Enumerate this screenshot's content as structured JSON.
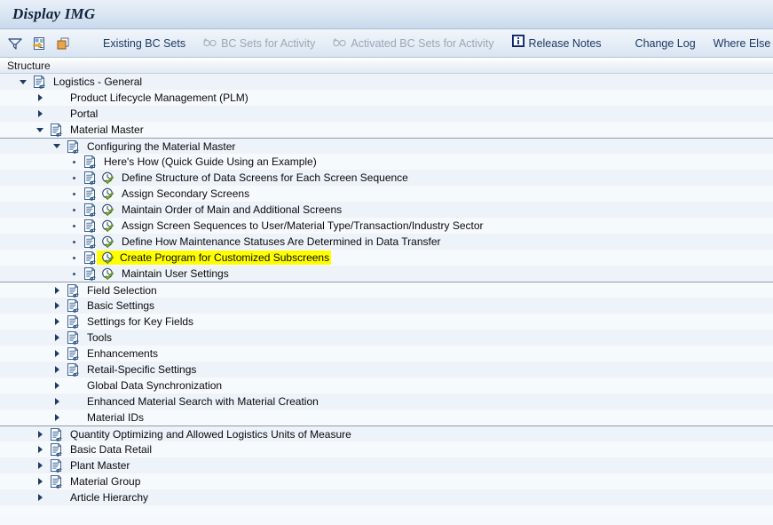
{
  "window": {
    "title": "Display IMG"
  },
  "toolbar": {
    "icons": [
      {
        "name": "filter-icon",
        "label": "Filter"
      },
      {
        "name": "display-details-icon",
        "label": "Display Details"
      },
      {
        "name": "copy-icon",
        "label": "Copy"
      }
    ],
    "buttons": [
      {
        "label": "Existing BC Sets",
        "disabled": false,
        "icon": "none"
      },
      {
        "label": "BC Sets for Activity",
        "disabled": true,
        "icon": "glasses-icon"
      },
      {
        "label": "Activated BC Sets for Activity",
        "disabled": true,
        "icon": "glasses-icon"
      },
      {
        "label": "Release Notes",
        "disabled": false,
        "icon": "info-icon"
      },
      {
        "label": "Change Log",
        "disabled": false,
        "icon": "none"
      },
      {
        "label": "Where Else Used",
        "disabled": false,
        "icon": "none"
      }
    ]
  },
  "structure": {
    "header": "Structure",
    "rows": [
      {
        "label": "Logistics - General",
        "indent": 0,
        "marker": "down",
        "doc": true,
        "clock": false,
        "highlight": false,
        "band": "a",
        "sep": false
      },
      {
        "label": "Product Lifecycle Management (PLM)",
        "indent": 1,
        "marker": "right",
        "doc": false,
        "clock": false,
        "highlight": false,
        "band": "b",
        "sep": false
      },
      {
        "label": "Portal",
        "indent": 1,
        "marker": "right",
        "doc": false,
        "clock": false,
        "highlight": false,
        "band": "a",
        "sep": false
      },
      {
        "label": "Material Master",
        "indent": 1,
        "marker": "down",
        "doc": true,
        "clock": false,
        "highlight": false,
        "band": "b",
        "sep": false
      },
      {
        "label": "Configuring the Material Master",
        "indent": 2,
        "marker": "down",
        "doc": true,
        "clock": false,
        "highlight": false,
        "band": "a",
        "sep": true
      },
      {
        "label": "Here's How (Quick Guide Using an Example)",
        "indent": 3,
        "marker": "dot",
        "doc": true,
        "clock": false,
        "highlight": false,
        "band": "b",
        "sep": false
      },
      {
        "label": "Define Structure of Data Screens for Each Screen Sequence",
        "indent": 3,
        "marker": "dot",
        "doc": true,
        "clock": true,
        "highlight": false,
        "band": "a",
        "sep": false
      },
      {
        "label": "Assign Secondary Screens",
        "indent": 3,
        "marker": "dot",
        "doc": true,
        "clock": true,
        "highlight": false,
        "band": "b",
        "sep": false
      },
      {
        "label": "Maintain Order of Main and Additional Screens",
        "indent": 3,
        "marker": "dot",
        "doc": true,
        "clock": true,
        "highlight": false,
        "band": "a",
        "sep": false
      },
      {
        "label": "Assign Screen Sequences to User/Material Type/Transaction/Industry Sector",
        "indent": 3,
        "marker": "dot",
        "doc": true,
        "clock": true,
        "highlight": false,
        "band": "b",
        "sep": false
      },
      {
        "label": "Define How Maintenance Statuses Are Determined in Data Transfer",
        "indent": 3,
        "marker": "dot",
        "doc": true,
        "clock": true,
        "highlight": false,
        "band": "a",
        "sep": false
      },
      {
        "label": "Create Program for Customized Subscreens",
        "indent": 3,
        "marker": "dot",
        "doc": true,
        "clock": true,
        "highlight": true,
        "band": "b",
        "sep": false
      },
      {
        "label": "Maintain User Settings",
        "indent": 3,
        "marker": "dot",
        "doc": true,
        "clock": true,
        "highlight": false,
        "band": "a",
        "sep": false
      },
      {
        "label": "Field Selection",
        "indent": 2,
        "marker": "right",
        "doc": true,
        "clock": false,
        "highlight": false,
        "band": "b",
        "sep": true
      },
      {
        "label": "Basic Settings",
        "indent": 2,
        "marker": "right",
        "doc": true,
        "clock": false,
        "highlight": false,
        "band": "a",
        "sep": false
      },
      {
        "label": "Settings for Key Fields",
        "indent": 2,
        "marker": "right",
        "doc": true,
        "clock": false,
        "highlight": false,
        "band": "b",
        "sep": false
      },
      {
        "label": "Tools",
        "indent": 2,
        "marker": "right",
        "doc": true,
        "clock": false,
        "highlight": false,
        "band": "a",
        "sep": false
      },
      {
        "label": "Enhancements",
        "indent": 2,
        "marker": "right",
        "doc": true,
        "clock": false,
        "highlight": false,
        "band": "b",
        "sep": false
      },
      {
        "label": "Retail-Specific Settings",
        "indent": 2,
        "marker": "right",
        "doc": true,
        "clock": false,
        "highlight": false,
        "band": "a",
        "sep": false
      },
      {
        "label": "Global Data Synchronization",
        "indent": 2,
        "marker": "right",
        "doc": false,
        "clock": false,
        "highlight": false,
        "band": "b",
        "sep": false
      },
      {
        "label": "Enhanced Material Search with Material Creation",
        "indent": 2,
        "marker": "right",
        "doc": false,
        "clock": false,
        "highlight": false,
        "band": "a",
        "sep": false
      },
      {
        "label": "Material IDs",
        "indent": 2,
        "marker": "right",
        "doc": false,
        "clock": false,
        "highlight": false,
        "band": "b",
        "sep": false
      },
      {
        "label": "Quantity Optimizing and Allowed Logistics Units of Measure",
        "indent": 1,
        "marker": "right",
        "doc": true,
        "clock": false,
        "highlight": false,
        "band": "a",
        "sep": true
      },
      {
        "label": "Basic Data Retail",
        "indent": 1,
        "marker": "right",
        "doc": true,
        "clock": false,
        "highlight": false,
        "band": "b",
        "sep": false
      },
      {
        "label": "Plant Master",
        "indent": 1,
        "marker": "right",
        "doc": true,
        "clock": false,
        "highlight": false,
        "band": "a",
        "sep": false
      },
      {
        "label": "Material Group",
        "indent": 1,
        "marker": "right",
        "doc": true,
        "clock": false,
        "highlight": false,
        "band": "b",
        "sep": false
      },
      {
        "label": "Article Hierarchy",
        "indent": 1,
        "marker": "right",
        "doc": false,
        "clock": false,
        "highlight": false,
        "band": "a",
        "sep": false
      }
    ]
  },
  "colors": {
    "highlight": "#ffff00",
    "title_text": "#11243d",
    "link_text": "#1b3a63",
    "disabled_text": "#9aa7b5"
  }
}
